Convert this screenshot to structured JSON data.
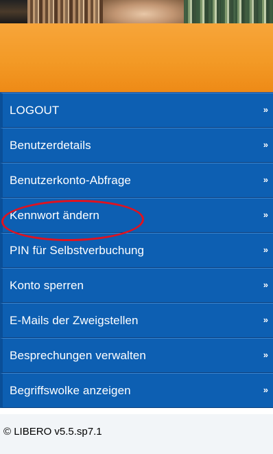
{
  "menu": {
    "items": [
      {
        "label": "LOGOUT",
        "chevron": "»"
      },
      {
        "label": "Benutzerdetails",
        "chevron": "»"
      },
      {
        "label": "Benutzerkonto-Abfrage",
        "chevron": "»"
      },
      {
        "label": "Kennwort ändern",
        "chevron": "»"
      },
      {
        "label": "PIN für Selbstverbuchung",
        "chevron": "»"
      },
      {
        "label": "Konto sperren",
        "chevron": "»"
      },
      {
        "label": "E-Mails der Zweigstellen",
        "chevron": "»"
      },
      {
        "label": "Besprechungen verwalten",
        "chevron": "»"
      },
      {
        "label": "Begriffswolke anzeigen",
        "chevron": "»"
      }
    ]
  },
  "footer": {
    "version": "© LIBERO v5.5.sp7.1"
  },
  "colors": {
    "menu_bg": "#0d5fb2",
    "header_orange": "#f39a26",
    "highlight": "#e0121f"
  }
}
